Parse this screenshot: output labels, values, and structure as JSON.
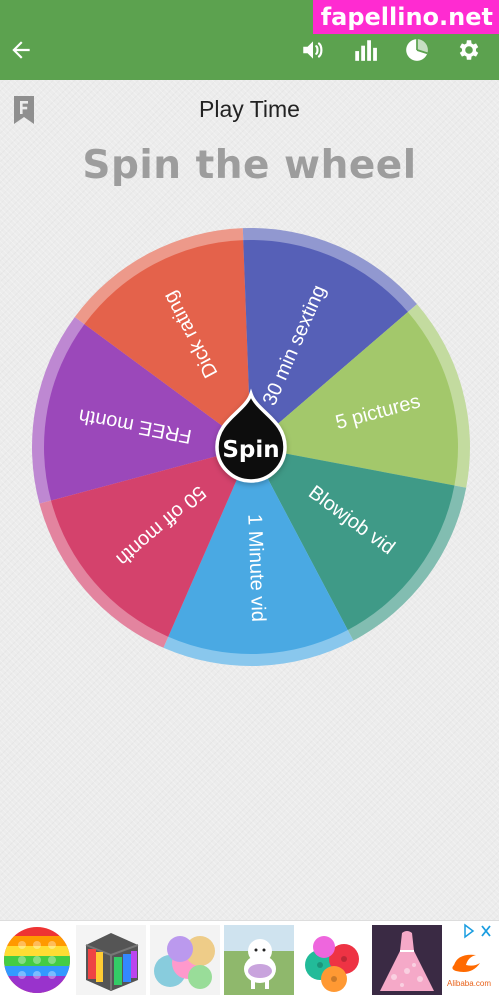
{
  "watermark": "fapellino.net",
  "header": {
    "back_icon": "arrow-left-icon",
    "actions": [
      "volume-icon",
      "bar-chart-icon",
      "pie-chart-icon",
      "gear-icon"
    ]
  },
  "page": {
    "subtitle": "Play Time",
    "title": "Spin the wheel"
  },
  "wheel": {
    "spin_label": "Spin",
    "segments": [
      {
        "label": "FREE month",
        "color": "#9b48ba"
      },
      {
        "label": "Dick rating",
        "color": "#e4624b"
      },
      {
        "label": "30 min sexting",
        "color": "#5660b7"
      },
      {
        "label": "5 pictures",
        "color": "#a3c86b"
      },
      {
        "label": "Blowjob vid",
        "color": "#3f9a87"
      },
      {
        "label": "1 Minute vid",
        "color": "#4aa9e3"
      },
      {
        "label": "50 off month",
        "color": "#d4426c"
      }
    ]
  },
  "ads": {
    "items": [
      "pop-it-toy",
      "magnetic-balls",
      "silicone-pads",
      "white-dog",
      "colorful-balls",
      "pink-dress"
    ],
    "brand": "Alibaba.com"
  }
}
